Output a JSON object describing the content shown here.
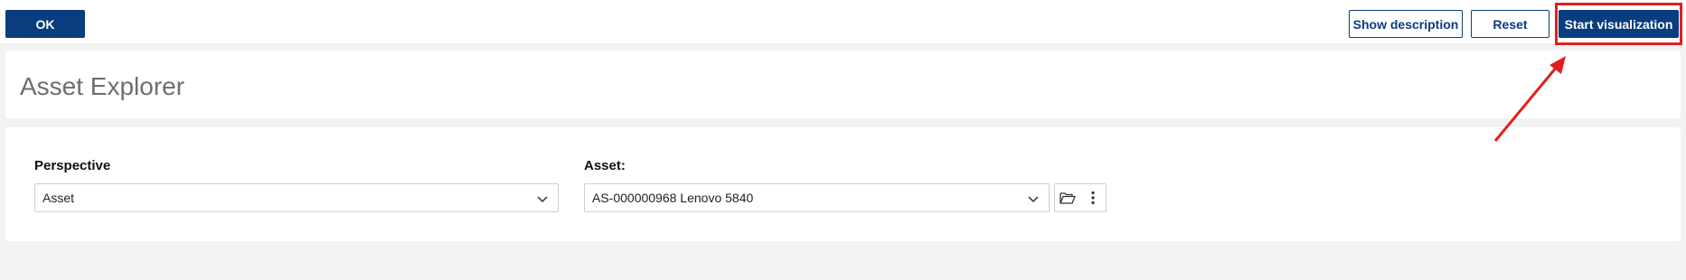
{
  "toolbar": {
    "ok_label": "OK",
    "show_description_label": "Show description",
    "reset_label": "Reset",
    "start_visualization_label": "Start visualization"
  },
  "page": {
    "title": "Asset Explorer"
  },
  "form": {
    "perspective": {
      "label": "Perspective",
      "value": "Asset"
    },
    "asset": {
      "label": "Asset:",
      "value": "AS-000000968 Lenovo 5840"
    }
  },
  "icons": {
    "chevron": "chevron-down-icon",
    "browse": "folder-open-icon",
    "more": "more-vertical-icon"
  },
  "colors": {
    "primary": "#0a3d7e",
    "annotation": "#e0201f",
    "title_text": "#6e6e6e"
  }
}
